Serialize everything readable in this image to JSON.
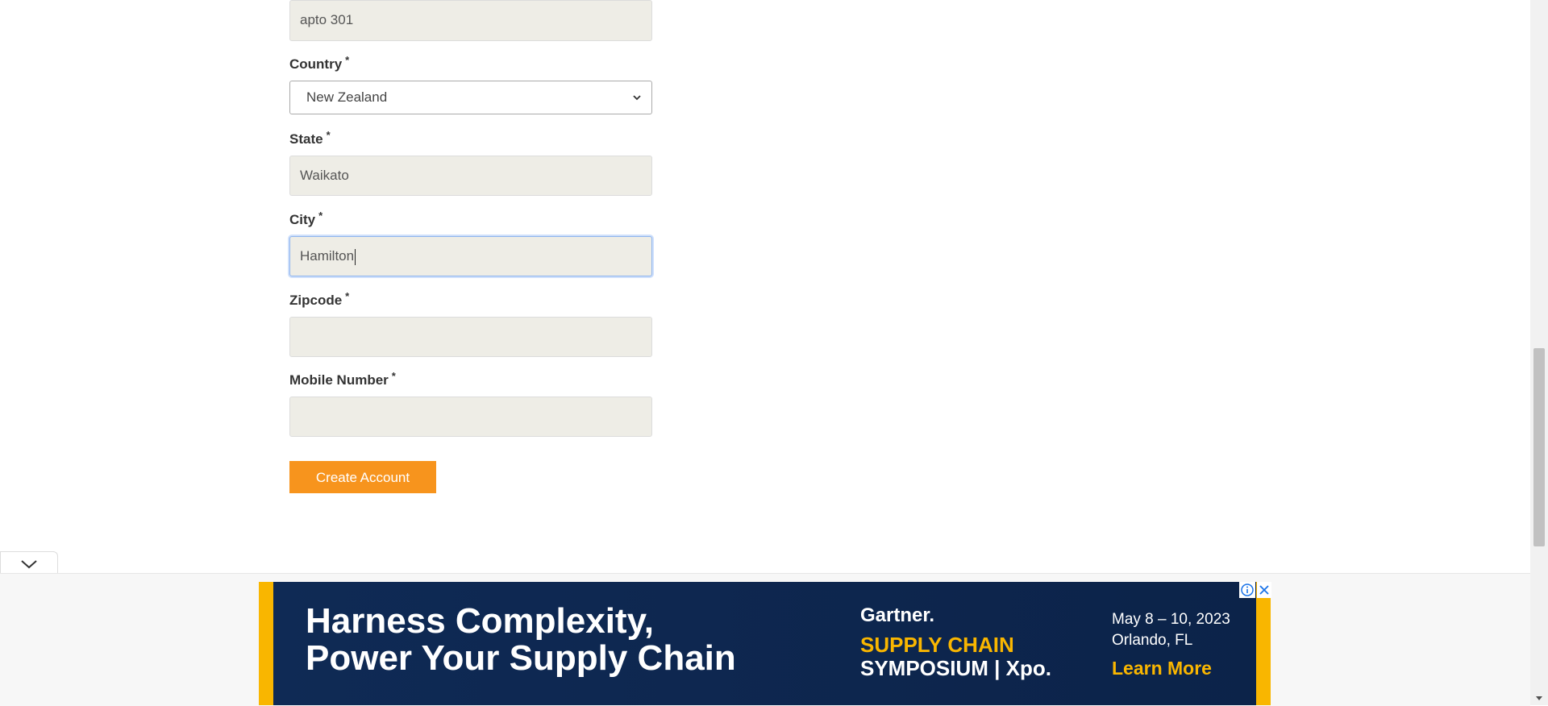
{
  "form": {
    "address2": {
      "value": "apto 301"
    },
    "country": {
      "label": "Country",
      "required_mark": "*",
      "selected": "New Zealand"
    },
    "state": {
      "label": "State",
      "required_mark": "*",
      "value": "Waikato"
    },
    "city": {
      "label": "City",
      "required_mark": "*",
      "value": "Hamilton"
    },
    "zipcode": {
      "label": "Zipcode",
      "required_mark": "*",
      "value": ""
    },
    "mobile": {
      "label": "Mobile Number",
      "required_mark": "*",
      "value": ""
    },
    "submit_label": "Create Account"
  },
  "ad": {
    "headline_line1": "Harness Complexity,",
    "headline_line2": "Power Your Supply Chain",
    "brand": "Gartner.",
    "symposium_line1": "SUPPLY CHAIN",
    "symposium_line2": "SYMPOSIUM | Xpo.",
    "date": "May 8 – 10, 2023",
    "location": "Orlando, FL",
    "cta": "Learn More"
  },
  "colors": {
    "button": "#f7941d",
    "ad_background": "#0f2a55",
    "ad_accent": "#f9b600",
    "input_background": "#eeede6"
  },
  "icons": {
    "select_arrow": "chevron-down-icon",
    "collapse": "chevron-down-icon",
    "ad_info": "info-icon",
    "ad_close": "close-icon"
  }
}
